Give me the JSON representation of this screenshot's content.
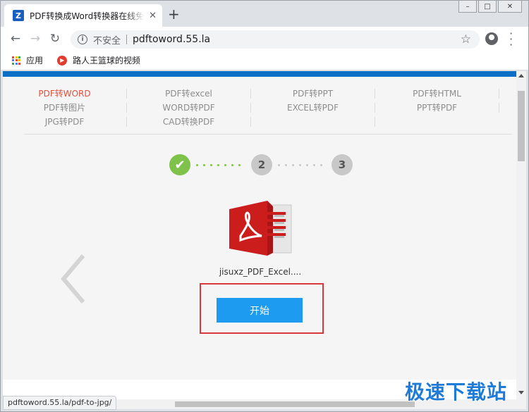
{
  "browser": {
    "tab_title": "PDF转换成Word转换器在线免费",
    "tab_favicon_letter": "Z",
    "new_tab_symbol": "+",
    "close_tab_symbol": "✕",
    "insecure_label": "不安全",
    "url": "pdftoword.55.la",
    "bookmarks": [
      {
        "label": "应用",
        "icon": "apps-grid-icon"
      },
      {
        "label": "路人王篮球的视频",
        "icon": "video-site-icon"
      }
    ],
    "status_url": "pdftoword.55.la/pdf-to-jpg/"
  },
  "page": {
    "nav_rows": [
      [
        "PDF转WORD",
        "PDF转excel",
        "PDF转PPT",
        "PDF转HTML"
      ],
      [
        "PDF转图片",
        "WORD转PDF",
        "EXCEL转PDF",
        "PPT转PDF"
      ],
      [
        "JPG转PDF",
        "CAD转换PDF"
      ]
    ],
    "active_nav": "PDF转WORD",
    "steps": {
      "step2": "2",
      "step3": "3"
    },
    "file_name": "jisuxz_PDF_Excel....",
    "start_label": "开始"
  },
  "watermark": "极速下载站",
  "colors": {
    "accent_blue": "#0b6fc6",
    "button_blue": "#1d9bf0",
    "step_green": "#7fc24b",
    "highlight_red": "#d9383a",
    "active_nav_red": "#e0503c"
  }
}
